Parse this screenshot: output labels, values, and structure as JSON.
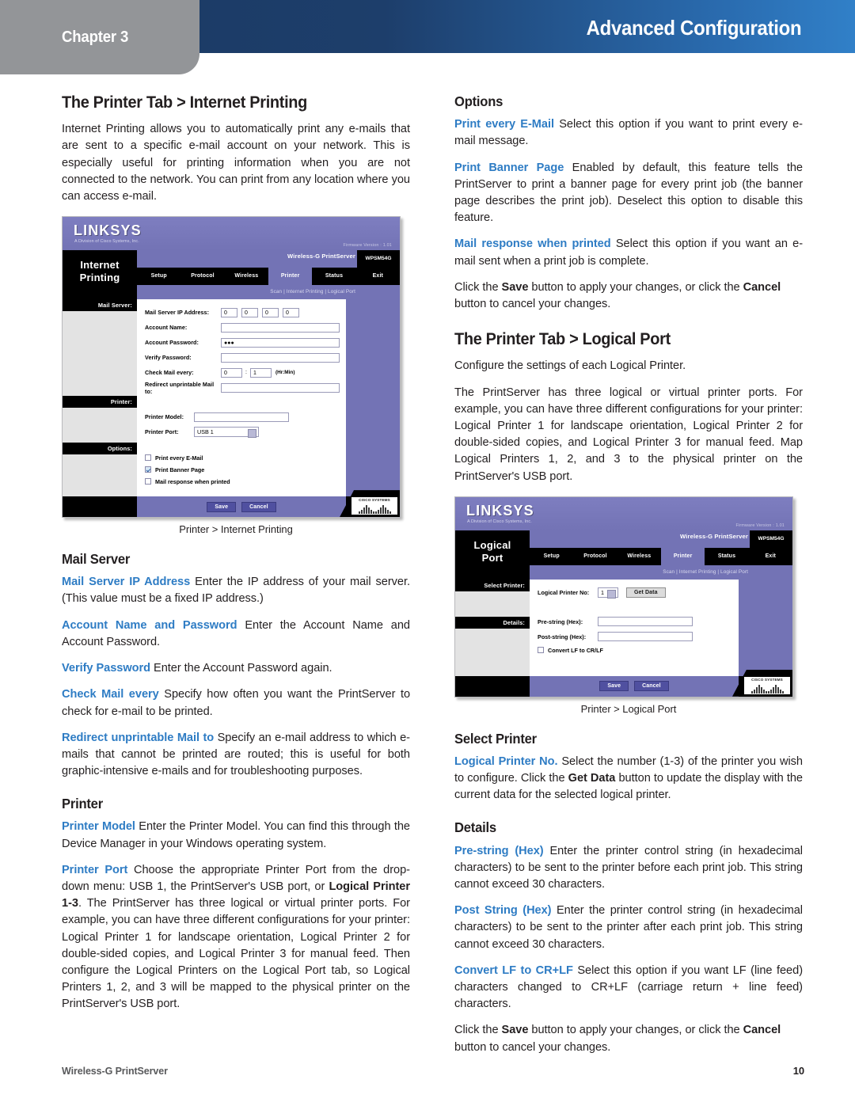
{
  "header": {
    "chapter": "Chapter 3",
    "title": "Advanced Configuration",
    "accent_dark": "#1b3a63",
    "accent_light": "#3180c8",
    "tab_gray": "#939598"
  },
  "footer": {
    "product": "Wireless-G PrintServer",
    "page_number": "10"
  },
  "left_column": {
    "heading": "The Printer Tab > Internet Printing",
    "intro": "Internet Printing allows you to automatically print any e-mails that are sent to a specific e-mail account on your network. This is especially useful for printing information when you are not connected to the network. You can print from any location where you can access e-mail.",
    "figure_caption": "Printer > Internet Printing",
    "mail_server_heading": "Mail Server",
    "items": [
      {
        "lead": "Mail Server IP Address",
        "text": " Enter the IP address of your mail server. (This value must be a fixed IP address.)"
      },
      {
        "lead": "Account Name and Password",
        "text": " Enter the Account Name and Account Password."
      },
      {
        "lead": "Verify Password",
        "text": " Enter the Account Password again."
      },
      {
        "lead": "Check Mail every",
        "text": " Specify how often you want the PrintServer to check for e-mail to be printed."
      },
      {
        "lead": "Redirect unprintable Mail to",
        "text": " Specify an e-mail address to which e-mails that cannot be printed are routed; this is useful for both graphic-intensive e-mails and for troubleshooting purposes."
      }
    ],
    "printer_heading": "Printer",
    "printer_items": [
      {
        "lead": "Printer Model",
        "text": " Enter the Printer Model. You can find this through the Device Manager in your Windows operating system."
      }
    ],
    "printer_port_lead": "Printer Port",
    "printer_port_a": " Choose the appropriate Printer Port from the drop-down menu: USB 1, the PrintServer's USB port, or ",
    "printer_port_bold": "Logical Printer 1-3",
    "printer_port_b": ". The PrintServer has three logical or virtual printer ports. For example, you can have three different configurations for your printer: Logical Printer 1 for landscape orientation, Logical Printer 2 for double-sided copies, and Logical Printer 3 for manual feed. Then configure the Logical Printers on the Logical Port tab, so Logical Printers 1, 2, and 3 will be mapped to the physical printer on the PrintServer's USB port."
  },
  "right_column": {
    "options_heading": "Options",
    "options_items": [
      {
        "lead": "Print every E-Mail",
        "text": " Select this option if you want to print every e-mail message."
      },
      {
        "lead": "Print Banner Page",
        "text": " Enabled by default, this feature tells the PrintServer to print a banner page for every print job (the banner page describes the print job). Deselect this option to disable this feature."
      },
      {
        "lead": "Mail response when printed",
        "text": " Select this option if you want an e-mail sent when a print job is complete."
      }
    ],
    "save_note_a": "Click the ",
    "save_note_save": "Save",
    "save_note_b": " button to apply your changes, or click the ",
    "save_note_cancel": "Cancel",
    "save_note_c": " button to cancel your changes.",
    "logical_heading": "The Printer Tab > Logical Port",
    "logical_intro1": "Configure the settings of each Logical Printer.",
    "logical_intro2": "The PrintServer has three logical or virtual printer ports. For example, you can have three different configurations for your printer: Logical Printer 1 for landscape orientation, Logical Printer 2 for double-sided copies, and Logical Printer 3 for manual feed. Map Logical Printers 1, 2, and 3 to the physical printer on the PrintServer's USB port.",
    "figure_caption": "Printer > Logical Port",
    "select_printer_heading": "Select Printer",
    "select_printer_lead": "Logical Printer No.",
    "select_printer_a": "  Select the number (1-3) of the printer you wish to configure. Click the ",
    "select_printer_bold": "Get Data",
    "select_printer_b": " button to update the display with the current data for the selected logical printer.",
    "details_heading": "Details",
    "details_items": [
      {
        "lead": "Pre-string (Hex)",
        "text": " Enter the printer control string (in hexadecimal characters) to be sent to the printer before each print job. This string cannot exceed 30 characters."
      },
      {
        "lead": "Post String (Hex)",
        "text": " Enter the printer control string (in hexadecimal characters) to be sent to the printer after each print job. This string cannot exceed 30 characters."
      },
      {
        "lead": "Convert LF to CR+LF",
        "text": " Select this option if you want LF (line feed) characters changed to CR+LF (carriage return + line feed) characters."
      }
    ]
  },
  "figure_internet_printing": {
    "brand": "LINKSYS",
    "brand_sub": "A Division of Cisco Systems, Inc.",
    "firmware": "Firmware Version :  1.01",
    "page_title_l1": "Internet",
    "page_title_l2": "Printing",
    "product": "Wireless-G PrintServer",
    "model": "WPSM54G",
    "tabs": [
      "Setup",
      "Protocol",
      "Wireless",
      "Printer",
      "Status",
      "Exit"
    ],
    "active_tab": "Printer",
    "subnav": "Scan   |   Internet Printing   |   Logical Port",
    "side_labels": [
      "Mail Server:",
      "Printer:",
      "Options:"
    ],
    "fields": {
      "ip_label": "Mail Server IP Address:",
      "ip_octets": [
        "0",
        "0",
        "0",
        "0"
      ],
      "account_name_label": "Account Name:",
      "account_name_value": "",
      "account_pw_label": "Account Password:",
      "account_pw_value": "●●●",
      "verify_pw_label": "Verify Password:",
      "verify_pw_value": "",
      "check_mail_label": "Check Mail every:",
      "check_mail_hr": "0",
      "check_mail_min": "1",
      "check_mail_units": "(Hr:Min)",
      "redirect_label": "Redirect unprintable Mail to:",
      "redirect_value": "",
      "printer_model_label": "Printer Model:",
      "printer_model_value": "",
      "printer_port_label": "Printer Port:",
      "printer_port_value": "USB 1"
    },
    "checkboxes": [
      {
        "label": "Print every E-Mail",
        "checked": false
      },
      {
        "label": "Print Banner Page",
        "checked": true
      },
      {
        "label": "Mail response when printed",
        "checked": false
      }
    ],
    "buttons": {
      "save": "Save",
      "cancel": "Cancel"
    },
    "cisco_logo": "CISCO SYSTEMS"
  },
  "figure_logical_port": {
    "brand": "LINKSYS",
    "brand_sub": "A Division of Cisco Systems, Inc.",
    "firmware": "Firmware Version :  1.01",
    "page_title_l1": "Logical",
    "page_title_l2": "Port",
    "product": "Wireless-G PrintServer",
    "model": "WPSM54G",
    "tabs": [
      "Setup",
      "Protocol",
      "Wireless",
      "Printer",
      "Status",
      "Exit"
    ],
    "active_tab": "Printer",
    "subnav": "Scan   |   Internet Printing   |   Logical Port",
    "side_labels": [
      "Select Printer:",
      "Details:"
    ],
    "fields": {
      "logical_no_label": "Logical Printer No:",
      "logical_no_value": "1",
      "get_data_button": "Get Data",
      "pre_string_label": "Pre-string (Hex):",
      "pre_string_value": "",
      "post_string_label": "Post-string (Hex):",
      "post_string_value": ""
    },
    "checkboxes": [
      {
        "label": "Convert LF to CR/LF",
        "checked": false
      }
    ],
    "buttons": {
      "save": "Save",
      "cancel": "Cancel"
    },
    "cisco_logo": "CISCO SYSTEMS"
  }
}
